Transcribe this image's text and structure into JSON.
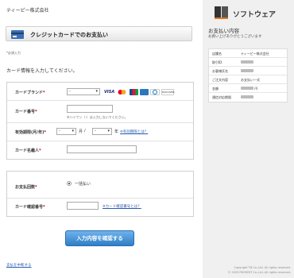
{
  "header": {
    "company": "ティーピー株式会社"
  },
  "title": {
    "text": "クレジットカードでのお支払い"
  },
  "required_note": "*必須入力",
  "intro": "カード情報を入力してください。",
  "form": {
    "brand": {
      "label": "カードブランド",
      "selected": "-"
    },
    "card_logos": [
      "VISA",
      "Mastercard",
      "JCB",
      "AMEX",
      "Diners Club",
      "DISCOVER"
    ],
    "number": {
      "label": "カード番号",
      "hint": "ハイフン（-）は入力しないでください。"
    },
    "expiry": {
      "label": "有効期限(月/年)",
      "month": "-",
      "month_unit": "月",
      "year": "-",
      "year_unit": "年",
      "help_link": "※有効期限とは？"
    },
    "holder": {
      "label": "カード名義人"
    }
  },
  "payment": {
    "count_label": "お支払回数",
    "count_option": "一括払い",
    "cvv_label": "カード確認番号",
    "cvv_link": "※カード確認番号とは？"
  },
  "confirm_button": "入力内容を確認する",
  "cancel_link": "支払を中断する",
  "sidebar": {
    "brand_name": "ソフトウェア",
    "title": "お支払い内容",
    "subtitle": "お買い上げありがとうございます",
    "rows": [
      {
        "key": "店舗名",
        "value": "ティーピー株式会社",
        "blurred": false
      },
      {
        "key": "取引ID",
        "value": "",
        "blurred": true
      },
      {
        "key": "お客様氏名",
        "value": "",
        "blurred": true
      },
      {
        "key": "ご注文内容",
        "value": "お支払い一式",
        "blurred": false
      },
      {
        "key": "金額",
        "value": "円",
        "blurred": true
      },
      {
        "key": "通信対応期限",
        "value": "",
        "blurred": true
      }
    ],
    "copyright1": "Copyright TB Co.,Ltd. All rights reserved.",
    "copyright2": "© 2025 PAYGENT Co.,Ltd. All rights reserved."
  },
  "colors": {
    "accent": "#2f7ec7",
    "link": "#2a5db0",
    "panel": "#f0f0f0"
  }
}
